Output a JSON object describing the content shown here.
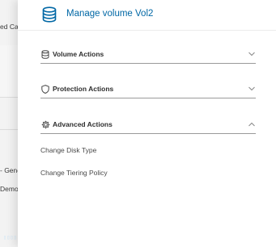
{
  "background": {
    "fragments": [
      "ed Ca",
      "- Gene",
      "Demo"
    ]
  },
  "panel": {
    "title": "Manage volume Vol2",
    "icon": "database-icon",
    "sections": [
      {
        "label": "Volume Actions",
        "icon": "database-icon",
        "state": "collapsed"
      },
      {
        "label": "Protection Actions",
        "icon": "shield-icon",
        "state": "collapsed"
      },
      {
        "label": "Advanced Actions",
        "icon": "gear-icon",
        "state": "expanded"
      }
    ],
    "advanced_actions": [
      "Change Disk Type",
      "Change Tiering Policy"
    ]
  },
  "colors": {
    "accent": "#0067a5",
    "section_text": "#2e2e2e",
    "divider": "#9a9a9a"
  }
}
